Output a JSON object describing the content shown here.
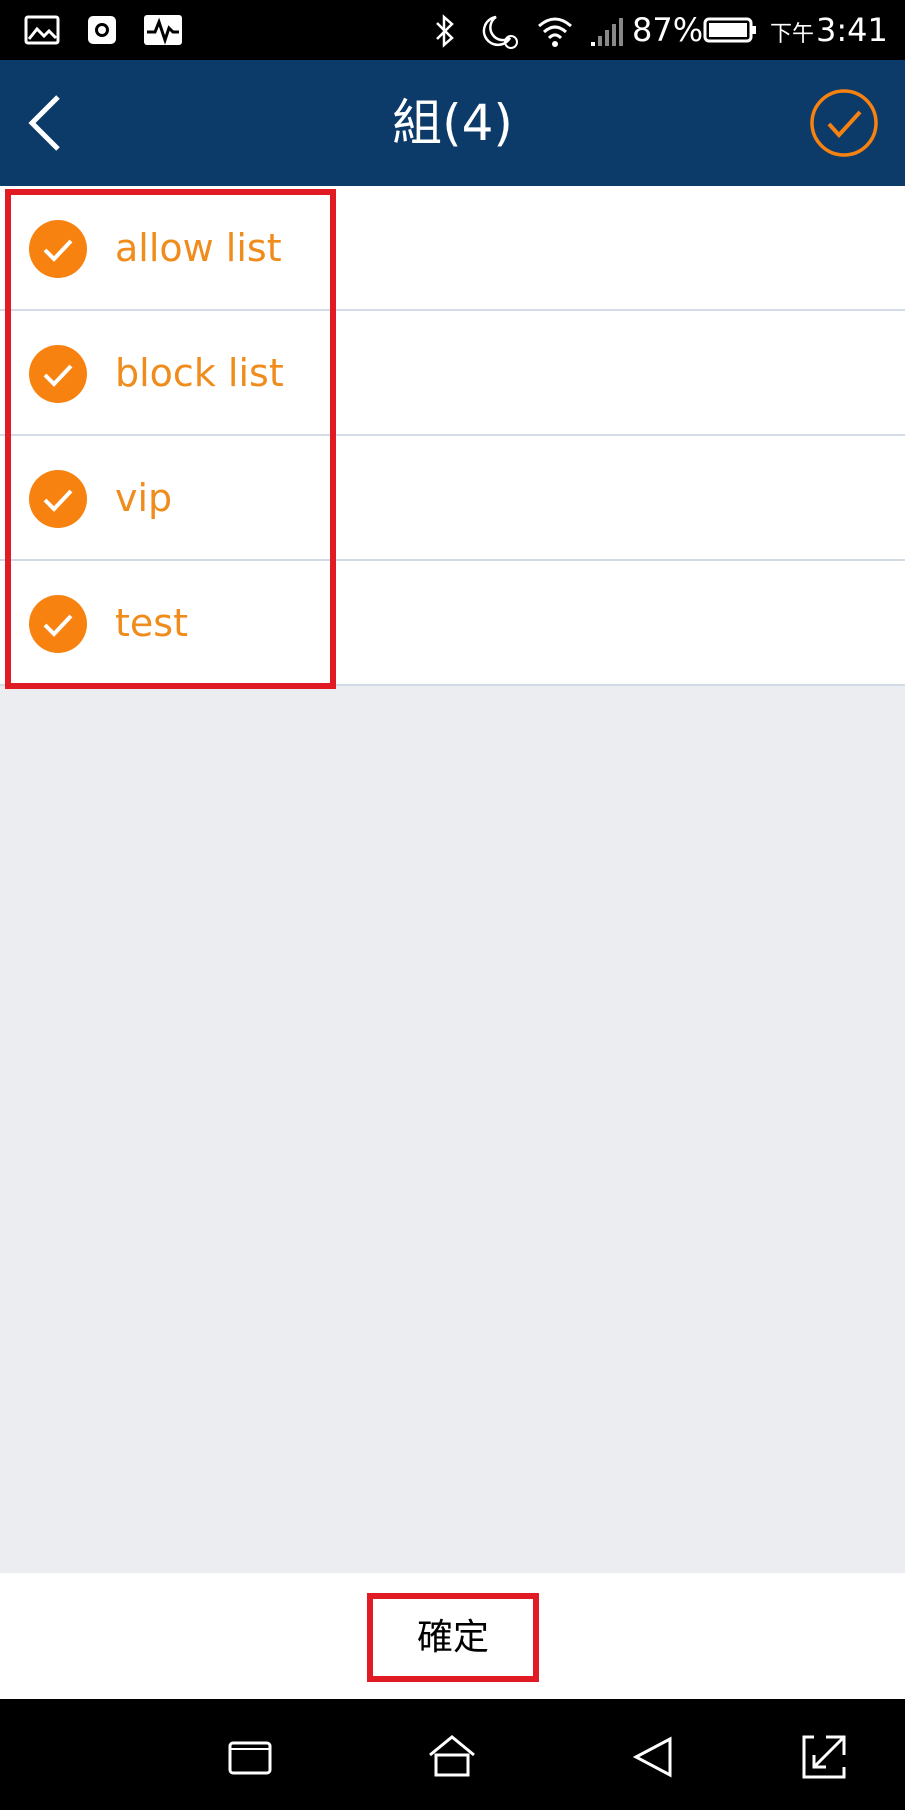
{
  "status_bar": {
    "left_icons": [
      "gallery-icon",
      "camera-circle-icon",
      "activity-icon"
    ],
    "right_icons": [
      "bluetooth-icon",
      "moon-alarm-icon",
      "wifi-icon",
      "signal-icon",
      "battery-icon"
    ],
    "battery_percent": "87%",
    "ampm": "下午",
    "time": "3:41"
  },
  "header": {
    "title": "組(4)",
    "back_icon": "chevron-left-icon",
    "confirm_icon": "check-circle-icon"
  },
  "groups": [
    {
      "label": "allow list",
      "checked": true
    },
    {
      "label": "block list",
      "checked": true
    },
    {
      "label": "vip",
      "checked": true
    },
    {
      "label": "test",
      "checked": true
    }
  ],
  "bottom": {
    "confirm_label": "確定"
  },
  "colors": {
    "accent": "#f7820f",
    "label": "#f08c1c",
    "header": "#0c3a69",
    "highlight": "#e01b24"
  },
  "nav_bar": {
    "icons": [
      "recent-apps-icon",
      "home-icon",
      "back-icon",
      "fullscreen-toggle-icon"
    ]
  }
}
